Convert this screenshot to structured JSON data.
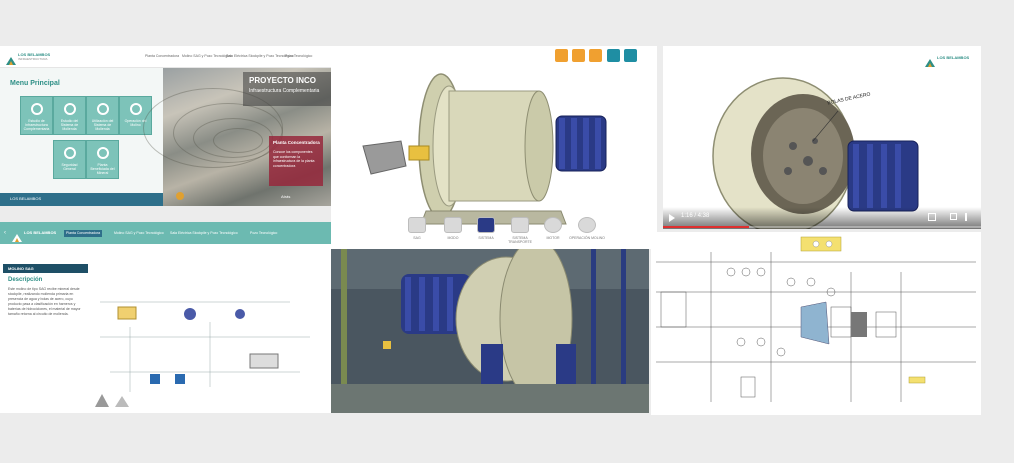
{
  "site_menu": {
    "brand": "LOS BELAMBOS",
    "brand_sub": "INFRAESTRUCTURA",
    "top_links": [
      "Planta Concentradora",
      "Molino SAG y Pozo Tecnológico",
      "Sala Eléctrica Stockpile y Pozo Tecnológico",
      "Pozo Tecnológico"
    ],
    "heading": "Menu Principal",
    "project_title": "PROYECTO INCO",
    "project_subtitle": "Infraestructura Complementaria",
    "tiles": [
      {
        "label": "Estudio de Infraestructura Complementaria"
      },
      {
        "label": "Estudio del Sistema de Molienda"
      },
      {
        "label": "Utilización del Sistema de Molienda"
      },
      {
        "label": "Operación del Molino"
      },
      {
        "label": "Seguridad General"
      },
      {
        "label": "Planta Beneficiada del Mineral"
      }
    ],
    "callout_title": "Planta Concentradora",
    "callout_text": "Conoce los componentes que conforman la infraestructura de la planta concentradora",
    "back_label": "Atrás",
    "footer_brand": "LOS BELAMBOS"
  },
  "viewer": {
    "toolbar_icons": [
      "headphones-icon",
      "screen-icon",
      "home-icon",
      "help-icon",
      "fullscreen-icon"
    ],
    "views": [
      {
        "label": "SAG"
      },
      {
        "label": "MODO"
      },
      {
        "label": "SISTEMA"
      },
      {
        "label": "SISTEMA TRANSPORTE"
      },
      {
        "label": "MOTOR"
      },
      {
        "label": "OPERACIÓN MOLINO"
      }
    ]
  },
  "video": {
    "brand": "LOS BELAMBOS",
    "annotation": "BOLAS DE ACERO",
    "time": "1:16 / 4:38",
    "progress_fraction": 0.27
  },
  "diagram_page": {
    "brand": "LOS BELAMBOS",
    "tabs": [
      "Planta Concentradora",
      "Molino SAG y Pozo Tecnológico",
      "Sala Eléctrica Stockpile y Pozo Tecnológico",
      "Pozo Tecnológico"
    ],
    "section": "MOLINO SAG",
    "description_title": "Descripción",
    "description_text": "Este molino de tipo SAG recibe mineral desde stockpile, realizando molienda primaria en presencia de agua y bolas de acero, cuyo producto pasa a clasificación en harneros y baterías de hidrociclones, el material de mayor tamaño retorna al circuito de molienda."
  }
}
